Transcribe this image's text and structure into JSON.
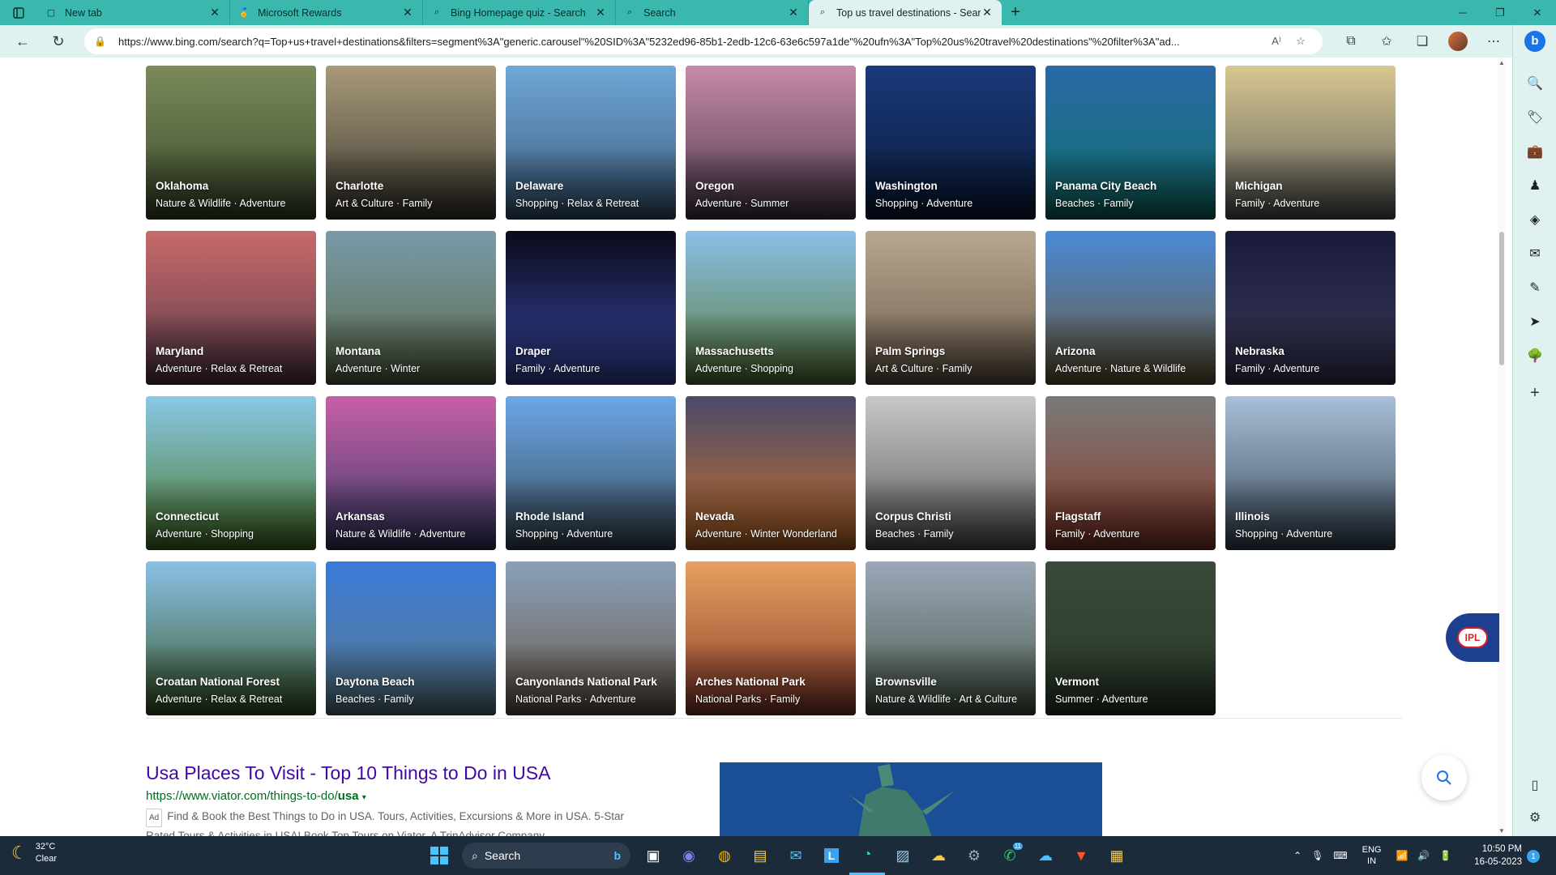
{
  "browser": {
    "tabs": [
      {
        "title": "New tab",
        "icon": "new-tab-icon"
      },
      {
        "title": "Microsoft Rewards",
        "icon": "rewards-icon"
      },
      {
        "title": "Bing Homepage quiz - Search",
        "icon": "search-icon"
      },
      {
        "title": "Search",
        "icon": "search-icon"
      },
      {
        "title": "Top us travel destinations - Search",
        "icon": "search-icon",
        "active": true
      }
    ],
    "address_url": "https://www.bing.com/search?q=Top+us+travel+destinations&filters=segment%3A\"generic.carousel\"%20SID%3A\"5232ed96-85b1-2edb-12c6-63e6c597a1de\"%20ufn%3A\"Top%20us%20travel%20destinations\"%20filter%3A\"ad..."
  },
  "destinations": [
    {
      "name": "Oklahoma",
      "tags": "Nature & Wildlife · Adventure",
      "colors": [
        "#7a8a5a",
        "#3b4a2c"
      ]
    },
    {
      "name": "Charlotte",
      "tags": "Art & Culture · Family",
      "colors": [
        "#a89a7a",
        "#3e3a32"
      ]
    },
    {
      "name": "Delaware",
      "tags": "Shopping · Relax & Retreat",
      "colors": [
        "#6fa8d8",
        "#3a5a7a"
      ]
    },
    {
      "name": "Oregon",
      "tags": "Adventure · Summer",
      "colors": [
        "#c88aa8",
        "#4a3a4a"
      ]
    },
    {
      "name": "Washington",
      "tags": "Shopping · Adventure",
      "colors": [
        "#1a3a7a",
        "#0a1a3a"
      ]
    },
    {
      "name": "Panama City Beach",
      "tags": "Beaches · Family",
      "colors": [
        "#2a6aa8",
        "#0f6f6a"
      ]
    },
    {
      "name": "Michigan",
      "tags": "Family · Adventure",
      "colors": [
        "#d8c890",
        "#5a5a5a"
      ]
    },
    {
      "name": "Maryland",
      "tags": "Adventure · Relax & Retreat",
      "colors": [
        "#c86a6a",
        "#5a3a4a"
      ]
    },
    {
      "name": "Montana",
      "tags": "Adventure · Winter",
      "colors": [
        "#7a9aa8",
        "#5a6a4a"
      ]
    },
    {
      "name": "Draper",
      "tags": "Family · Adventure",
      "colors": [
        "#0a0a1a",
        "#3a4aa8"
      ]
    },
    {
      "name": "Massachusetts",
      "tags": "Adventure · Shopping",
      "colors": [
        "#8ac0e8",
        "#5a7a3a"
      ]
    },
    {
      "name": "Palm Springs",
      "tags": "Art & Culture · Family",
      "colors": [
        "#b8a890",
        "#6a5a4a"
      ]
    },
    {
      "name": "Arizona",
      "tags": "Adventure · Nature & Wildlife",
      "colors": [
        "#4a8ad8",
        "#6a5a3a"
      ]
    },
    {
      "name": "Nebraska",
      "tags": "Family · Adventure",
      "colors": [
        "#1a1a3a",
        "#3a3a5a"
      ]
    },
    {
      "name": "Connecticut",
      "tags": "Adventure · Shopping",
      "colors": [
        "#8ac8e8",
        "#4a7a2a"
      ]
    },
    {
      "name": "Arkansas",
      "tags": "Nature & Wildlife · Adventure",
      "colors": [
        "#c860a8",
        "#3a3a6a"
      ]
    },
    {
      "name": "Rhode Island",
      "tags": "Shopping · Adventure",
      "colors": [
        "#6aa8e8",
        "#3a4a5a"
      ]
    },
    {
      "name": "Nevada",
      "tags": "Adventure · Winter Wonderland",
      "colors": [
        "#4a4a6a",
        "#c8702a"
      ]
    },
    {
      "name": "Corpus Christi",
      "tags": "Beaches · Family",
      "colors": [
        "#c8c8c8",
        "#5a5a5a"
      ]
    },
    {
      "name": "Flagstaff",
      "tags": "Family · Adventure",
      "colors": [
        "#7a7a7a",
        "#8a3a2a"
      ]
    },
    {
      "name": "Illinois",
      "tags": "Shopping · Adventure",
      "colors": [
        "#a8c0d8",
        "#3a4a5a"
      ]
    },
    {
      "name": "Croatan National Forest",
      "tags": "Adventure · Relax & Retreat",
      "colors": [
        "#8ac0e8",
        "#3a5a2a"
      ]
    },
    {
      "name": "Daytona Beach",
      "tags": "Beaches · Family",
      "colors": [
        "#3a7ad8",
        "#5a7a8a"
      ]
    },
    {
      "name": "Canyonlands National Park",
      "tags": "National Parks · Adventure",
      "colors": [
        "#8aa0b8",
        "#6a5a4a"
      ]
    },
    {
      "name": "Arches National Park",
      "tags": "National Parks · Family",
      "colors": [
        "#e8a060",
        "#8a3a2a"
      ]
    },
    {
      "name": "Brownsville",
      "tags": "Nature & Wildlife · Art & Culture",
      "colors": [
        "#9aa8b8",
        "#4a5a4a"
      ]
    },
    {
      "name": "Vermont",
      "tags": "Summer · Adventure",
      "colors": [
        "#3a4a3a",
        "#2a3a2a"
      ]
    }
  ],
  "result": {
    "title": "Usa Places To Visit - Top 10 Things to Do in USA",
    "url_prefix": "https://www.viator.com/things-to-do/",
    "url_bold": "usa",
    "ad_label": "Ad",
    "snippet": "Find & Book the Best Things to Do in USA. Tours, Activities, Excursions & More in USA. 5-Star Rated Tours & Activities in USA! Book Top Tours on Viator, A TripAdvisor Company"
  },
  "widgets": {
    "ipl_label": "IPL"
  },
  "taskbar": {
    "weather_temp": "32°C",
    "weather_cond": "Clear",
    "search_label": "Search",
    "lang_top": "ENG",
    "lang_bottom": "IN",
    "time": "10:50 PM",
    "date": "16-05-2023",
    "notif_count": "1",
    "whatsapp_badge": "11"
  }
}
